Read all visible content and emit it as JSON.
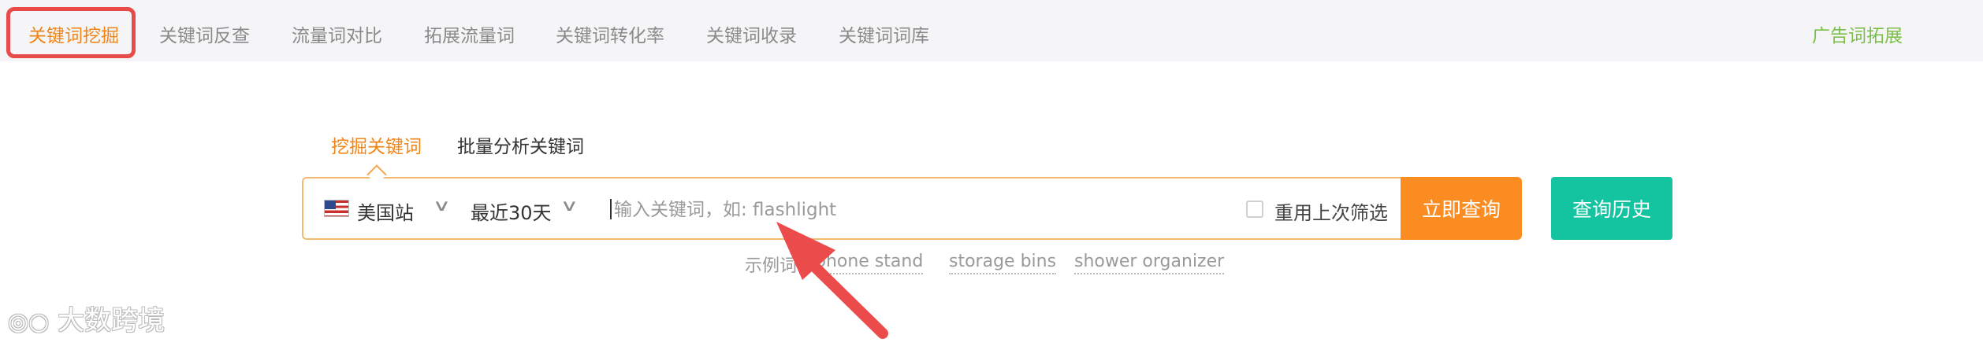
{
  "topnav": {
    "tabs": [
      {
        "label": "关键词挖掘"
      },
      {
        "label": "关键词反查"
      },
      {
        "label": "流量词对比"
      },
      {
        "label": "拓展流量词"
      },
      {
        "label": "关键词转化率"
      },
      {
        "label": "关键词收录"
      },
      {
        "label": "关键词词库"
      }
    ],
    "ad_tab": "广告词拓展"
  },
  "subtabs": {
    "mine": "挖掘关键词",
    "batch": "批量分析关键词"
  },
  "search": {
    "site": "美国站",
    "period": "最近30天",
    "placeholder": "输入关键词，如: flashlight",
    "reuse_filter_label": "重用上次筛选",
    "query_button": "立即查询",
    "history_button": "查询历史"
  },
  "examples": {
    "prefix": "示例词:",
    "items": [
      "phone stand",
      "storage bins",
      "shower organizer"
    ]
  },
  "watermark": "大数跨境",
  "colors": {
    "accent_orange": "#fa8c22",
    "teal": "#14c39f",
    "highlight_red": "#e84a4a",
    "ad_green": "#7bbf4a"
  }
}
